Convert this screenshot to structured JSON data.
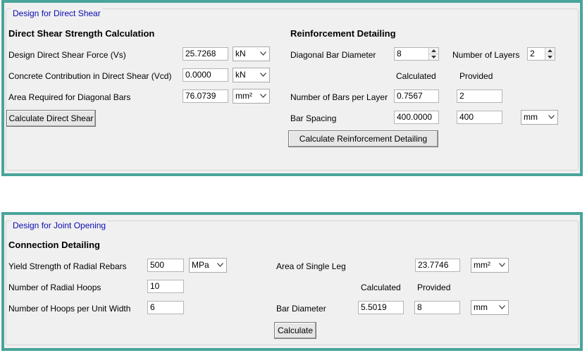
{
  "direct_shear": {
    "group_title": "Design for Direct Shear",
    "strength": {
      "heading": "Direct Shear Strength Calculation",
      "force_label": "Design Direct Shear Force (Vs)",
      "force_value": "25.7268",
      "force_unit": "kN",
      "concrete_label": "Concrete Contribution in Direct Shear (Vcd)",
      "concrete_value": "0.0000",
      "concrete_unit": "kN",
      "area_label": "Area Required for Diagonal Bars",
      "area_value": "76.0739",
      "area_unit": "mm²",
      "calc_button": "Calculate Direct Shear"
    },
    "reinforcement": {
      "heading": "Reinforcement Detailing",
      "diameter_label": "Diagonal Bar Diameter",
      "diameter_value": "8",
      "layers_label": "Number of Layers",
      "layers_value": "2",
      "calculated_header": "Calculated",
      "provided_header": "Provided",
      "bars_label": "Number of Bars per Layer",
      "bars_calculated": "0.7567",
      "bars_provided": "2",
      "spacing_label": "Bar Spacing",
      "spacing_calculated": "400.0000",
      "spacing_provided": "400",
      "spacing_unit": "mm",
      "calc_button": "Calculate Reinforcement Detailing"
    }
  },
  "joint_opening": {
    "group_title": "Design for Joint Opening",
    "heading": "Connection Detailing",
    "yield_label": "Yield Strength of Radial Rebars",
    "yield_value": "500",
    "yield_unit": "MPa",
    "hoops_label": "Number of Radial Hoops",
    "hoops_value": "10",
    "hoops_width_label": "Number of Hoops per Unit Width",
    "hoops_width_value": "6",
    "area_leg_label": "Area of Single Leg",
    "area_leg_value": "23.7746",
    "area_leg_unit": "mm²",
    "calculated_header": "Calculated",
    "provided_header": "Provided",
    "bar_diameter_label": "Bar Diameter",
    "bar_diameter_calculated": "5.5019",
    "bar_diameter_provided": "8",
    "bar_diameter_unit": "mm",
    "calc_button": "Calculate"
  },
  "colors": {
    "panel_border": "#4aa49a",
    "group_title": "#0b0bb4",
    "panel_bg": "#f0f0f0"
  }
}
